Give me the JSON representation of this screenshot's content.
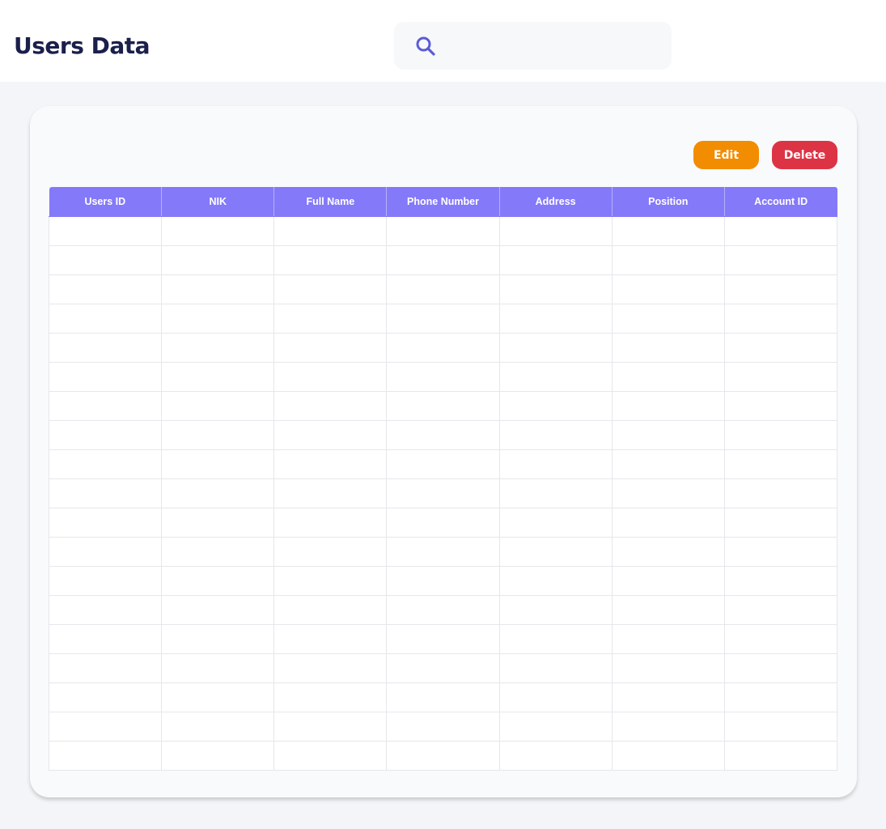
{
  "header": {
    "title": "Users Data",
    "search": {
      "placeholder": "",
      "value": "",
      "icon": "search-icon"
    }
  },
  "toolbar": {
    "edit_label": "Edit",
    "delete_label": "Delete"
  },
  "colors": {
    "title": "#1b1f4b",
    "accent": "#8479f8",
    "search_icon": "#5b5bd6",
    "edit": "#f28c00",
    "delete": "#dc3445",
    "background": "#f4f5f8"
  },
  "table": {
    "columns": [
      "Users ID",
      "NIK",
      "Full Name",
      "Phone Number",
      "Address",
      "Position",
      "Account ID"
    ],
    "rows": [
      [
        "",
        "",
        "",
        "",
        "",
        "",
        ""
      ],
      [
        "",
        "",
        "",
        "",
        "",
        "",
        ""
      ],
      [
        "",
        "",
        "",
        "",
        "",
        "",
        ""
      ],
      [
        "",
        "",
        "",
        "",
        "",
        "",
        ""
      ],
      [
        "",
        "",
        "",
        "",
        "",
        "",
        ""
      ],
      [
        "",
        "",
        "",
        "",
        "",
        "",
        ""
      ],
      [
        "",
        "",
        "",
        "",
        "",
        "",
        ""
      ],
      [
        "",
        "",
        "",
        "",
        "",
        "",
        ""
      ],
      [
        "",
        "",
        "",
        "",
        "",
        "",
        ""
      ],
      [
        "",
        "",
        "",
        "",
        "",
        "",
        ""
      ],
      [
        "",
        "",
        "",
        "",
        "",
        "",
        ""
      ],
      [
        "",
        "",
        "",
        "",
        "",
        "",
        ""
      ],
      [
        "",
        "",
        "",
        "",
        "",
        "",
        ""
      ],
      [
        "",
        "",
        "",
        "",
        "",
        "",
        ""
      ],
      [
        "",
        "",
        "",
        "",
        "",
        "",
        ""
      ],
      [
        "",
        "",
        "",
        "",
        "",
        "",
        ""
      ],
      [
        "",
        "",
        "",
        "",
        "",
        "",
        ""
      ],
      [
        "",
        "",
        "",
        "",
        "",
        "",
        ""
      ],
      [
        "",
        "",
        "",
        "",
        "",
        "",
        ""
      ]
    ]
  }
}
